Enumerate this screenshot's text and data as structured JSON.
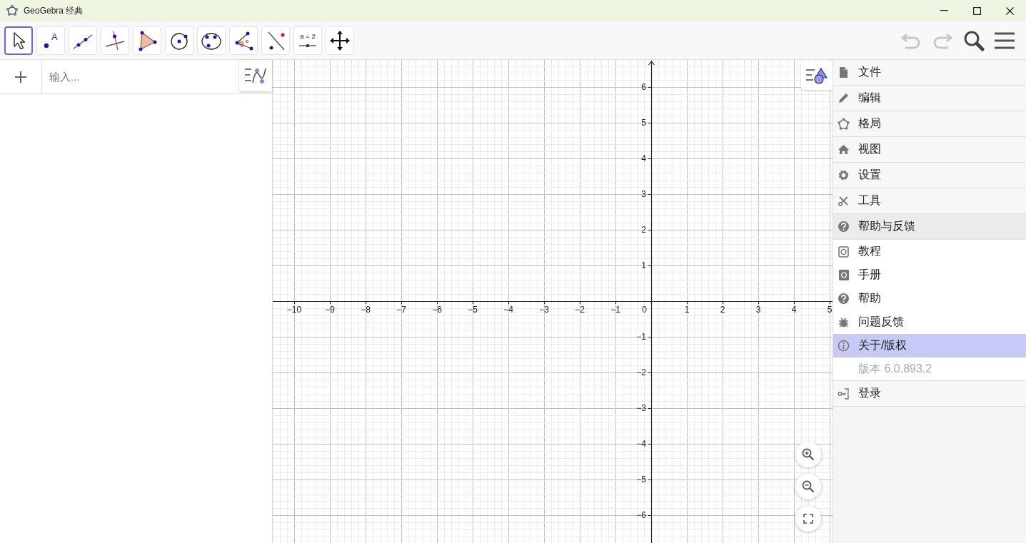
{
  "window": {
    "title": "GeoGebra 经典"
  },
  "toolbar": {
    "tools": [
      {
        "selected": true
      },
      {
        "selected": false,
        "label": "A"
      },
      {
        "selected": false
      },
      {
        "selected": false
      },
      {
        "selected": false
      },
      {
        "selected": false
      },
      {
        "selected": false
      },
      {
        "selected": false
      },
      {
        "selected": false
      },
      {
        "selected": false,
        "label": "a = 2"
      },
      {
        "selected": false
      }
    ],
    "undo": {
      "disabled": true
    },
    "redo": {
      "disabled": true
    }
  },
  "algebra": {
    "input": {
      "placeholder": "输入..."
    }
  },
  "graphics": {
    "x_labels_negative": [
      "−10",
      "−9",
      "−8",
      "−7",
      "−6",
      "−5",
      "−4",
      "−3",
      "−2",
      "−1"
    ],
    "origin_label": "0",
    "x_labels_positive": [
      "1",
      "2",
      "3",
      "4",
      "5"
    ],
    "y_labels_positive": [
      "6",
      "5",
      "4",
      "3",
      "2",
      "1"
    ],
    "y_labels_negative": [
      "−1",
      "−2",
      "−3",
      "−4",
      "−5",
      "−6"
    ]
  },
  "menu": {
    "items": [
      {
        "label": "文件",
        "expanded": false
      },
      {
        "label": "编辑",
        "expanded": false
      },
      {
        "label": "格局",
        "expanded": false
      },
      {
        "label": "视图",
        "expanded": false
      },
      {
        "label": "设置",
        "expanded": false
      },
      {
        "label": "工具",
        "expanded": false
      },
      {
        "label": "帮助与反馈",
        "expanded": true,
        "children": [
          {
            "label": "教程",
            "selected": false,
            "disabled": false
          },
          {
            "label": "手册",
            "selected": false,
            "disabled": false
          },
          {
            "label": "帮助",
            "selected": false,
            "disabled": false
          },
          {
            "label": "问题反馈",
            "selected": false,
            "disabled": false
          },
          {
            "label": "关于/版权",
            "selected": true,
            "disabled": false
          },
          {
            "label": "版本 6.0.893.2",
            "selected": false,
            "disabled": true
          }
        ]
      },
      {
        "label": "登录",
        "expanded": false
      }
    ]
  }
}
